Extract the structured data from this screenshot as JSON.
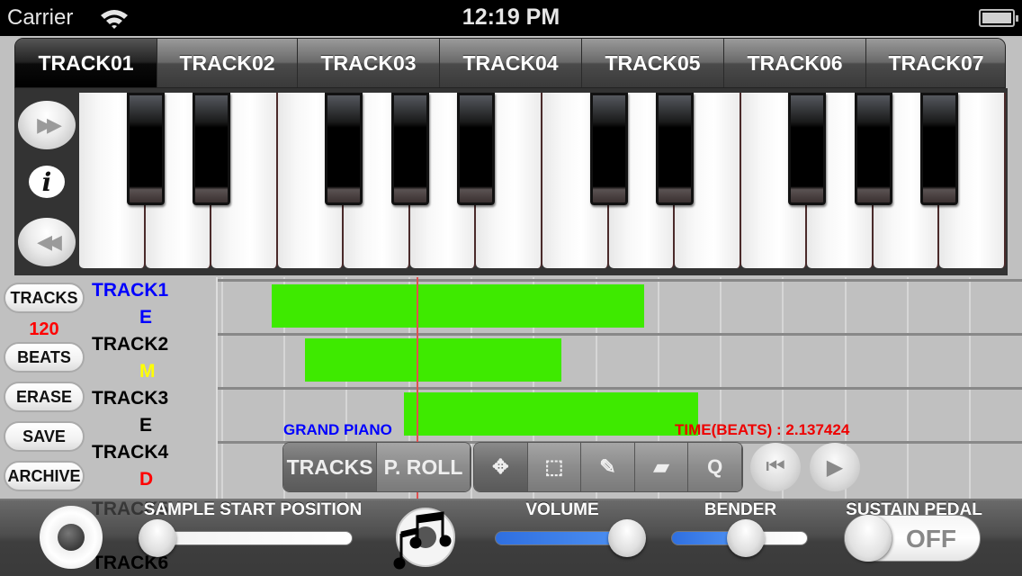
{
  "status_bar": {
    "carrier": "Carrier",
    "wifi_icon": "wifi-icon",
    "time": "12:19 PM",
    "battery_icon": "battery-icon"
  },
  "tabs": [
    {
      "label": "TRACK01",
      "selected": true
    },
    {
      "label": "TRACK02",
      "selected": false
    },
    {
      "label": "TRACK03",
      "selected": false
    },
    {
      "label": "TRACK04",
      "selected": false
    },
    {
      "label": "TRACK05",
      "selected": false
    },
    {
      "label": "TRACK06",
      "selected": false
    },
    {
      "label": "TRACK07",
      "selected": false
    }
  ],
  "piano_controls": {
    "octave_up_icon": "fast-forward-icon",
    "info_icon": "info-icon",
    "info_glyph": "i",
    "octave_down_icon": "rewind-icon",
    "ff_glyph": "▶▶",
    "rw_glyph": "◀◀",
    "white_keys": 14,
    "black_key_pattern": [
      1,
      1,
      0,
      1,
      1,
      1,
      0,
      1,
      1,
      0,
      1,
      1,
      1
    ]
  },
  "side_buttons": {
    "tracks": "TRACKS",
    "tempo": "120",
    "beats": "BEATS",
    "erase": "ERASE",
    "save": "SAVE",
    "archive": "ARCHIVE"
  },
  "track_list": [
    {
      "name": "TRACK1",
      "mode": "E",
      "name_color": "#0000ff",
      "mode_color": "#0000ff"
    },
    {
      "name": "TRACK2",
      "mode": "M",
      "name_color": "#000000",
      "mode_color": "#ffff00"
    },
    {
      "name": "TRACK3",
      "mode": "E",
      "name_color": "#000000",
      "mode_color": "#000000"
    },
    {
      "name": "TRACK4",
      "mode": "D",
      "name_color": "#000000",
      "mode_color": "#ff0000"
    },
    {
      "name": "TRACK5",
      "mode": "",
      "name_color": "#000000",
      "mode_color": "#ff0000"
    },
    {
      "name": "TRACK6",
      "mode": "",
      "name_color": "#000000",
      "mode_color": "#000000"
    }
  ],
  "timeline": {
    "note_color": "#3eea00",
    "playhead_color": "#e05050",
    "instrument": "GRAND PIANO",
    "time_readout": "TIME(BEATS) : 2.137424",
    "regions": [
      {
        "row": 0,
        "start_beat": -0.19,
        "end_beat": 5.79
      },
      {
        "row": 1,
        "start_beat": 0.35,
        "end_beat": 4.46
      },
      {
        "row": 2,
        "start_beat": 1.94,
        "end_beat": 6.65
      }
    ],
    "playhead_beat": 2.137424
  },
  "mode_segment": [
    {
      "label": "TRACKS",
      "selected": true
    },
    {
      "label": "P. ROLL",
      "selected": false
    }
  ],
  "tool_segment": [
    {
      "icon": "move-arrows-icon",
      "glyph": "✥",
      "selected": true
    },
    {
      "icon": "select-box-icon",
      "glyph": "⬚",
      "selected": false
    },
    {
      "icon": "pencil-icon",
      "glyph": "✎",
      "selected": false
    },
    {
      "icon": "eraser-icon",
      "glyph": "▰",
      "selected": false
    },
    {
      "icon": "quantize-icon",
      "glyph": "Q",
      "selected": false
    }
  ],
  "transport": {
    "rewind_glyph": "⏮",
    "play_glyph": "▶"
  },
  "bottom_bar": {
    "sample_start_label": "SAMPLE START POSITION",
    "sample_start_value": 0.0,
    "volume_label": "VOLUME",
    "volume_value": 1.0,
    "bender_label": "BENDER",
    "bender_value": 0.5,
    "sustain_label": "SUSTAIN PEDAL",
    "sustain_state": "OFF",
    "accent_color": "#2f6fe0"
  }
}
